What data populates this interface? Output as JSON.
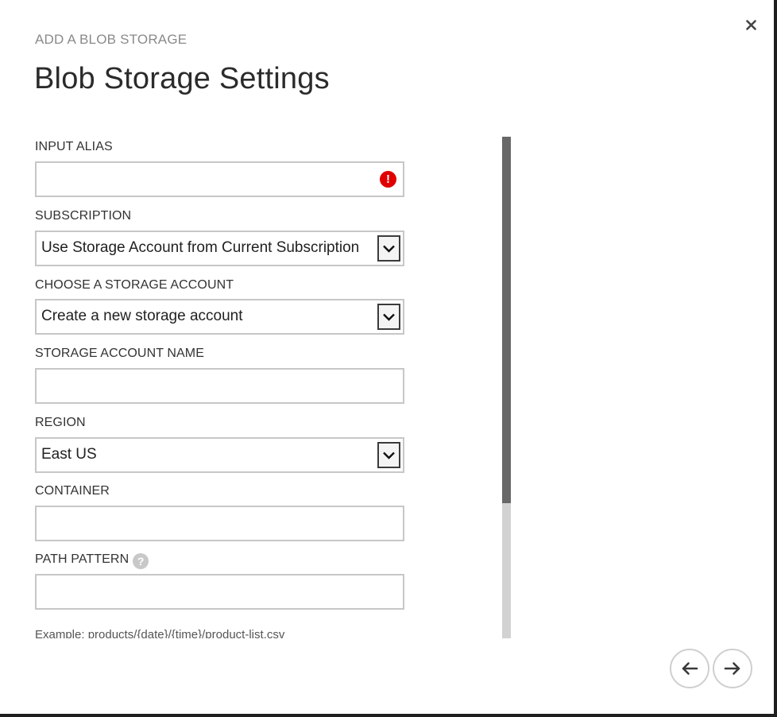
{
  "dialog": {
    "subtitle": "ADD A BLOB STORAGE",
    "title": "Blob Storage Settings",
    "close_icon": "close-icon"
  },
  "form": {
    "input_alias": {
      "label": "INPUT ALIAS",
      "value": "",
      "status": "error",
      "status_icon": "error-icon"
    },
    "subscription": {
      "label": "SUBSCRIPTION",
      "value": "Use Storage Account from Current Subscription"
    },
    "storage_account": {
      "label": "CHOOSE A STORAGE ACCOUNT",
      "value": "Create a new storage account"
    },
    "storage_account_name": {
      "label": "STORAGE ACCOUNT NAME",
      "value": ""
    },
    "region": {
      "label": "REGION",
      "value": "East US"
    },
    "container": {
      "label": "CONTAINER",
      "value": ""
    },
    "path_pattern": {
      "label": "PATH PATTERN",
      "value": "",
      "help_glyph": "?",
      "help_icon": "help-icon"
    },
    "example": "Example: products/{date}/{time}/product-list.csv"
  },
  "scrollbar": {
    "position_fraction": 0.0,
    "visible_fraction": 0.73
  },
  "footer": {
    "back_icon": "arrow-left-icon",
    "next_icon": "arrow-right-icon"
  },
  "colors": {
    "error": "#e00000",
    "field_border": "#c7c7c7",
    "scroll_thumb": "#686868",
    "scroll_track": "#d2d2d2"
  }
}
